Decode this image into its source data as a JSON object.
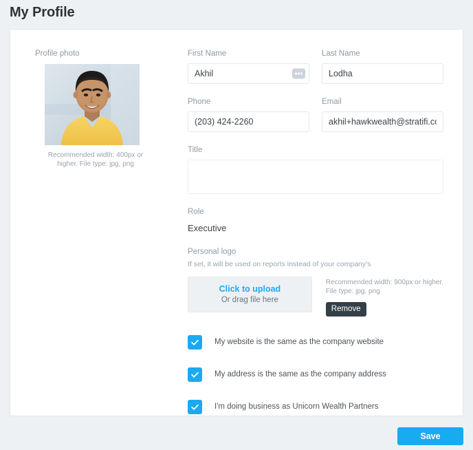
{
  "page": {
    "title": "My Profile",
    "background_color": "#eef1f3",
    "accent_color": "#17abf0"
  },
  "profile_photo": {
    "label": "Profile photo",
    "hint": "Recommended width: 400px or higher. File type: jpg, png",
    "alt": "Headshot of a smiling man wearing a yellow sweater over a light blue collared shirt, blurred outdoor background"
  },
  "form": {
    "first_name": {
      "label": "First Name",
      "value": "Akhil",
      "autofill_icon": "ellipsis-icon"
    },
    "last_name": {
      "label": "Last Name",
      "value": "Lodha"
    },
    "phone": {
      "label": "Phone",
      "value": "(203) 424-2260"
    },
    "email": {
      "label": "Email",
      "value": "akhil+hawkwealth@stratifi.cor"
    },
    "title": {
      "label": "Title",
      "value": "",
      "placeholder": ""
    },
    "role": {
      "label": "Role",
      "value": "Executive"
    }
  },
  "personal_logo": {
    "label": "Personal logo",
    "helper": "If set, it will be used on reports instead of your company's",
    "dropzone": {
      "primary": "Click to upload",
      "secondary": "Or drag file here"
    },
    "note_line1": "Recommended width: 900px or higher.",
    "note_line2": "File type: jpg, png",
    "remove_label": "Remove"
  },
  "checkboxes": [
    {
      "label": "My website is the same as the company website",
      "checked": true,
      "icon": "check-icon"
    },
    {
      "label": "My address is the same as the company address",
      "checked": true,
      "icon": "check-icon"
    },
    {
      "label": "I'm doing business as Unicorn Wealth Partners",
      "checked": true,
      "icon": "check-icon"
    }
  ],
  "actions": {
    "save_label": "Save"
  }
}
